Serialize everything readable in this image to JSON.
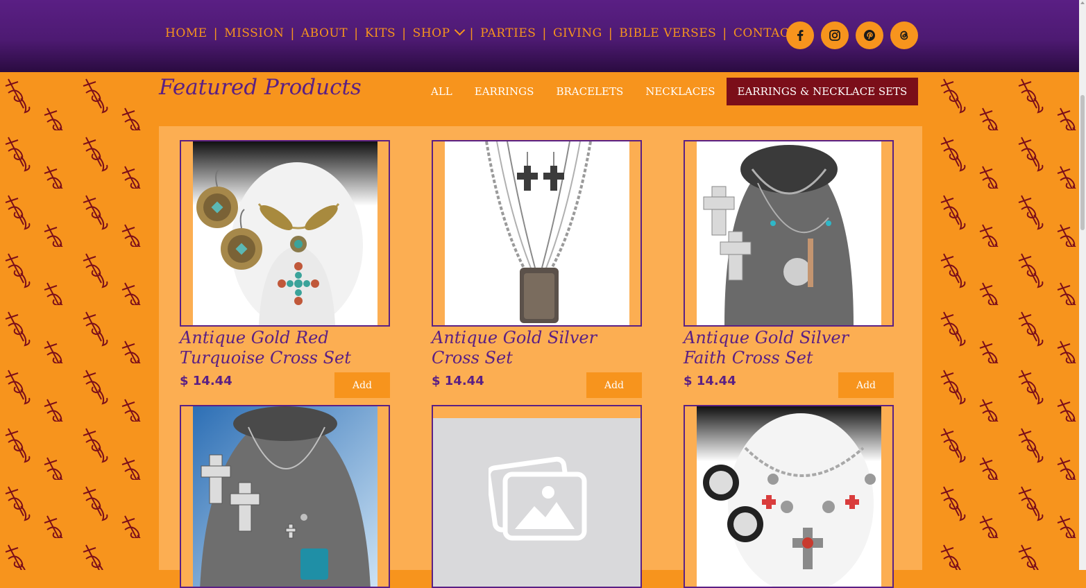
{
  "nav": {
    "items": [
      {
        "label": "HOME"
      },
      {
        "label": "MISSION"
      },
      {
        "label": "ABOUT"
      },
      {
        "label": "KITS"
      },
      {
        "label": "SHOP"
      },
      {
        "label": "PARTIES"
      },
      {
        "label": "GIVING"
      },
      {
        "label": "BIBLE VERSES"
      },
      {
        "label": "CONTACT"
      }
    ],
    "separator": "|"
  },
  "social": [
    "facebook-icon",
    "instagram-icon",
    "pinterest-icon",
    "threads-icon"
  ],
  "section": {
    "title": "Featured Products",
    "filters": [
      {
        "label": "ALL",
        "active": false
      },
      {
        "label": "EARRINGS",
        "active": false
      },
      {
        "label": "BRACELETS",
        "active": false
      },
      {
        "label": "NECKLACES",
        "active": false
      },
      {
        "label": "EARRINGS & NECKLACE SETS",
        "active": true
      }
    ]
  },
  "products": [
    {
      "name": "Antique Gold Red Turquoise Cross Set",
      "price": "$ 14.44",
      "add_label": "Add"
    },
    {
      "name": "Antique Gold Silver Cross Set",
      "price": "$ 14.44",
      "add_label": "Add"
    },
    {
      "name": "Antique Gold Silver Faith Cross Set",
      "price": "$ 14.44",
      "add_label": "Add"
    }
  ],
  "colors": {
    "orange": "#f7941d",
    "light_orange": "#fcae52",
    "purple": "#5a1f84",
    "active_filter": "#7b0e19"
  }
}
